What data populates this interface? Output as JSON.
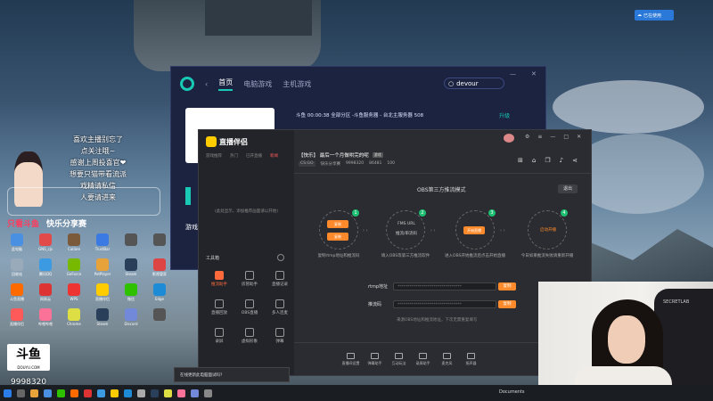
{
  "desktop": {
    "corner_tag": "已在使用",
    "overlay_lines": [
      "喜欢主播别忘了",
      "点关注哦~",
      "感谢上周投喜官❤",
      "想要只猫带看流派",
      "戏精请私信",
      "人要请进来"
    ],
    "banner_left": "只看斗鱼",
    "banner_right": "快乐分享赛",
    "room_number": "9998320",
    "douyu_logo": "斗鱼",
    "douyu_sub": "DOUYU.COM",
    "icons": [
      {
        "label": "此电脑",
        "color": "#4a90e2"
      },
      {
        "label": "GNS_cjs",
        "color": "#e24a4a"
      },
      {
        "label": "Calibre",
        "color": "#7a5a3a"
      },
      {
        "label": "TrustBar",
        "color": "#3a7ae2"
      },
      {
        "label": "",
        "color": "#555"
      },
      {
        "label": "",
        "color": "#555"
      },
      {
        "label": "回收站",
        "color": "#9ab"
      },
      {
        "label": "腾讯QQ",
        "color": "#3b9ae1"
      },
      {
        "label": "GeForce",
        "color": "#76b900"
      },
      {
        "label": "PotPlayer",
        "color": "#e8a23a"
      },
      {
        "label": "Steam",
        "color": "#2a3f5a"
      },
      {
        "label": "影视管家",
        "color": "#d44"
      },
      {
        "label": "斗鱼直播",
        "color": "#ff6a00"
      },
      {
        "label": "网易云",
        "color": "#d33"
      },
      {
        "label": "WPS",
        "color": "#e33"
      },
      {
        "label": "直播伴侣",
        "color": "#ffcc00"
      },
      {
        "label": "微信",
        "color": "#2dc100"
      },
      {
        "label": "Edge",
        "color": "#1e8bd6"
      },
      {
        "label": "直播伴侣",
        "color": "#ff5a5a"
      },
      {
        "label": "哔哩哔哩",
        "color": "#fb7299"
      },
      {
        "label": "Chrome",
        "color": "#dd4"
      },
      {
        "label": "Steam",
        "color": "#2a3f5a"
      },
      {
        "label": "Discord",
        "color": "#7289da"
      },
      {
        "label": "",
        "color": "#555"
      }
    ]
  },
  "back_window": {
    "nav": [
      "首页",
      "电脑游戏",
      "主机游戏"
    ],
    "search_value": "devour",
    "ticker": "斗鱼 00:00:38 全部分区 -斗鱼服务器 - 台北主服务器 508",
    "upgrade": "升级",
    "game_label": "游戏"
  },
  "main_window": {
    "app_name": "直播伴侣",
    "left_tabs": [
      "游戏推荐",
      "热门",
      "已开直播",
      "新闻"
    ],
    "left_empty": "(此处显示，添加推荐画面请以开始)",
    "tools_heading": "工具箱",
    "tools": [
      {
        "label": "推流助手",
        "hot": true
      },
      {
        "label": "房管助手",
        "hot": false
      },
      {
        "label": "直播记录",
        "hot": false
      },
      {
        "label": "直播回放",
        "hot": false
      },
      {
        "label": "OBS直播",
        "hot": false
      },
      {
        "label": "多人连麦",
        "hot": false
      },
      {
        "label": "录屏",
        "hot": false
      },
      {
        "label": "虚拟形象",
        "hot": false
      },
      {
        "label": "弹幕",
        "hot": false
      }
    ],
    "room_title": "【快乐】 最后一个月做哄完的呢",
    "room_tag": "游戏",
    "room_category": "CS:GO",
    "room_meta": [
      "快乐分享赛",
      "9998320",
      "86481",
      "100"
    ],
    "obs_title": "OBS第三方推流模式",
    "exit_btn": "退出",
    "steps": [
      {
        "num": "1",
        "pill": "复制",
        "pill2": "复制",
        "desc": "复制rtmp地址和推流码"
      },
      {
        "num": "2",
        "line1": "FMS URL",
        "line2": "推流/串流码",
        "desc": "填入OBS等第三方推流软件"
      },
      {
        "num": "3",
        "pill": "开始直播",
        "desc": "进入OBS开始推流后点击开始直播"
      },
      {
        "num": "4",
        "line1": "启动开播",
        "desc": "今日如果推流失败请重新开播"
      }
    ],
    "rtmp_label": "rtmp地址",
    "rtmp_value": "********************************",
    "key_label": "推流码",
    "key_value": "********************************",
    "copy_label": "复制",
    "hint": "来源OBS地址和推流地址，下次无需重复填写",
    "bottom": [
      "直播间设置",
      "弹幕助手",
      "互动玩法",
      "录屏助手",
      "麦克风",
      "扬声器"
    ]
  },
  "webcam": {
    "chair_brand": "SECRETLAB"
  },
  "taskbar": {
    "tooltip": "在线更新此电脑面试吗?",
    "documents": "Documents"
  }
}
